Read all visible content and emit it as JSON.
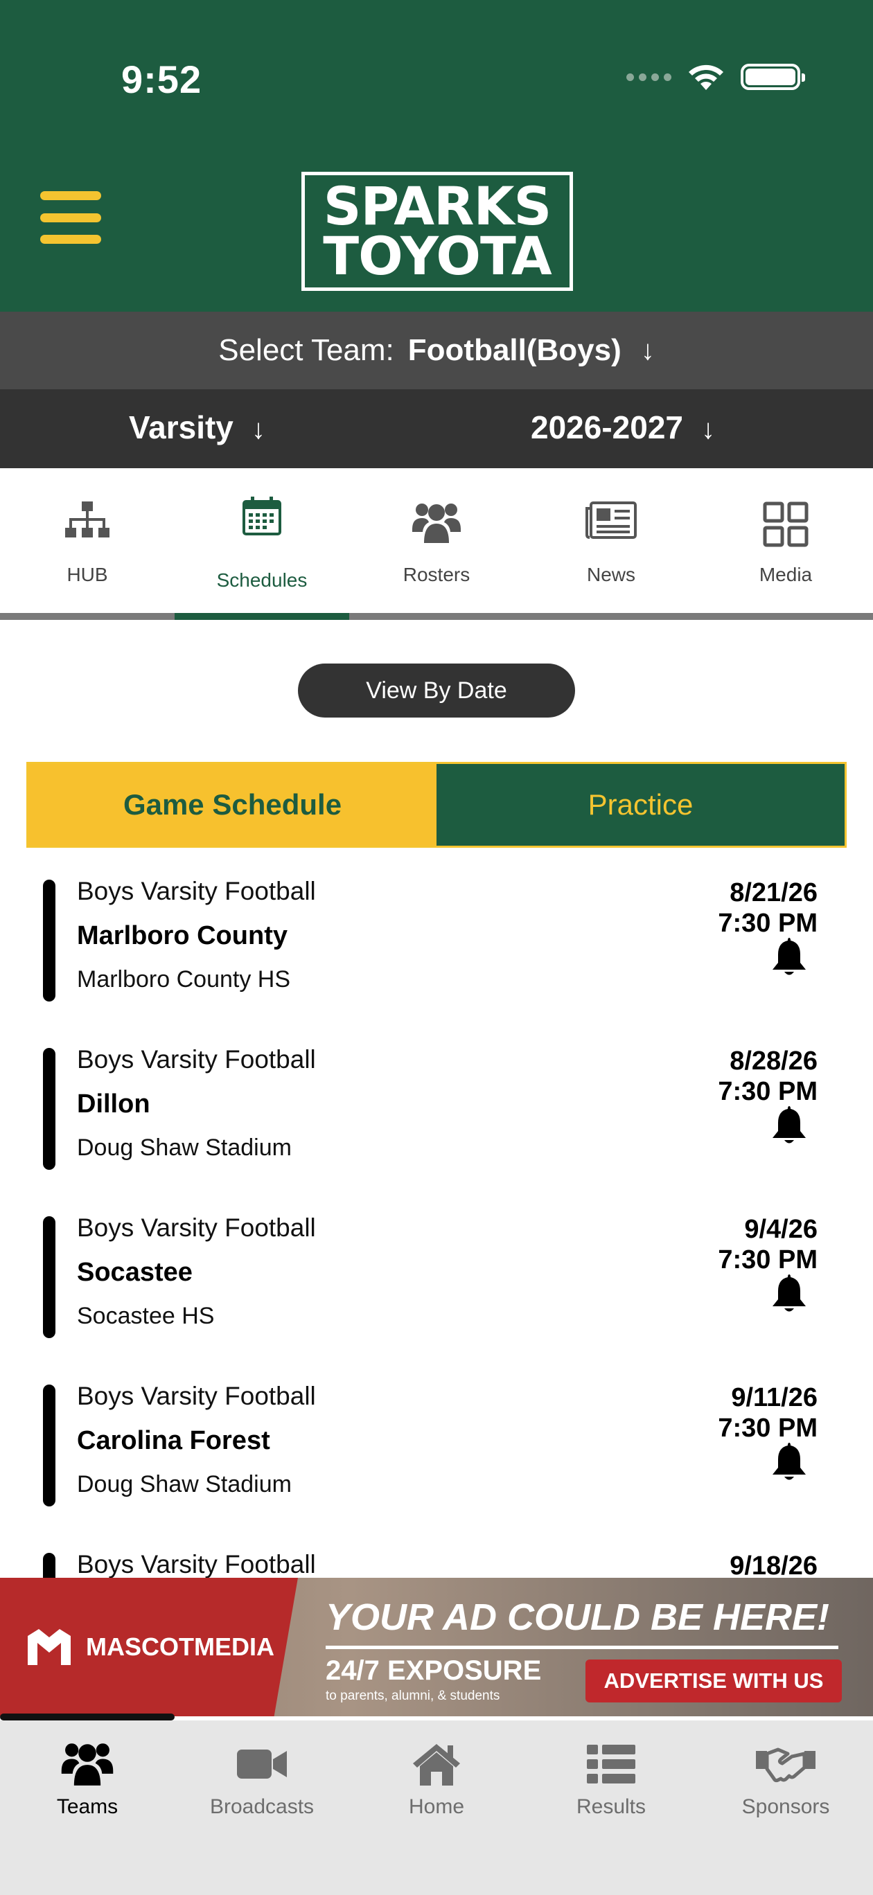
{
  "status_bar": {
    "time": "9:52"
  },
  "header": {
    "logo_line1": "SPARKS",
    "logo_line2": "TOYOTA",
    "accent_color": "#1d5c40",
    "highlight_color": "#f4c430"
  },
  "team_select": {
    "label": "Select Team:",
    "value": "Football(Boys)",
    "arrow": "↓"
  },
  "level_select": {
    "value": "Varsity",
    "arrow": "↓"
  },
  "season_select": {
    "value": "2026-2027",
    "arrow": "↓"
  },
  "tabs": [
    {
      "label": "HUB",
      "icon": "sitemap-icon"
    },
    {
      "label": "Schedules",
      "icon": "calendar-icon",
      "active": true
    },
    {
      "label": "Rosters",
      "icon": "users-icon"
    },
    {
      "label": "News",
      "icon": "newspaper-icon"
    },
    {
      "label": "Media",
      "icon": "grid-icon"
    }
  ],
  "view_by_date": "View By Date",
  "schedule_toggle": {
    "game": "Game Schedule",
    "practice": "Practice"
  },
  "games": [
    {
      "sport": "Boys Varsity Football",
      "opponent": "Marlboro County",
      "venue": "Marlboro County HS",
      "date": "8/21/26",
      "time": "7:30 PM"
    },
    {
      "sport": "Boys Varsity Football",
      "opponent": "Dillon",
      "venue": "Doug Shaw Stadium",
      "date": "8/28/26",
      "time": "7:30 PM"
    },
    {
      "sport": "Boys Varsity Football",
      "opponent": "Socastee",
      "venue": "Socastee HS",
      "date": "9/4/26",
      "time": "7:30 PM"
    },
    {
      "sport": "Boys Varsity Football",
      "opponent": "Carolina Forest",
      "venue": "Doug Shaw Stadium",
      "date": "9/11/26",
      "time": "7:30 PM"
    },
    {
      "sport": "Boys Varsity Football",
      "opponent": "",
      "venue": "",
      "date": "9/18/26",
      "time": ""
    }
  ],
  "ad": {
    "brand": "MASCOTMEDIA",
    "headline": "YOUR AD COULD BE HERE!",
    "subhead": "24/7 EXPOSURE",
    "small": "to parents, alumni, & students",
    "cta": "ADVERTISE WITH US",
    "carousel_progress": 0.2
  },
  "bottom_nav": [
    {
      "label": "Teams",
      "icon": "users-icon",
      "active": true
    },
    {
      "label": "Broadcasts",
      "icon": "video-camera-icon"
    },
    {
      "label": "Home",
      "icon": "home-icon"
    },
    {
      "label": "Results",
      "icon": "list-icon"
    },
    {
      "label": "Sponsors",
      "icon": "handshake-icon"
    }
  ]
}
